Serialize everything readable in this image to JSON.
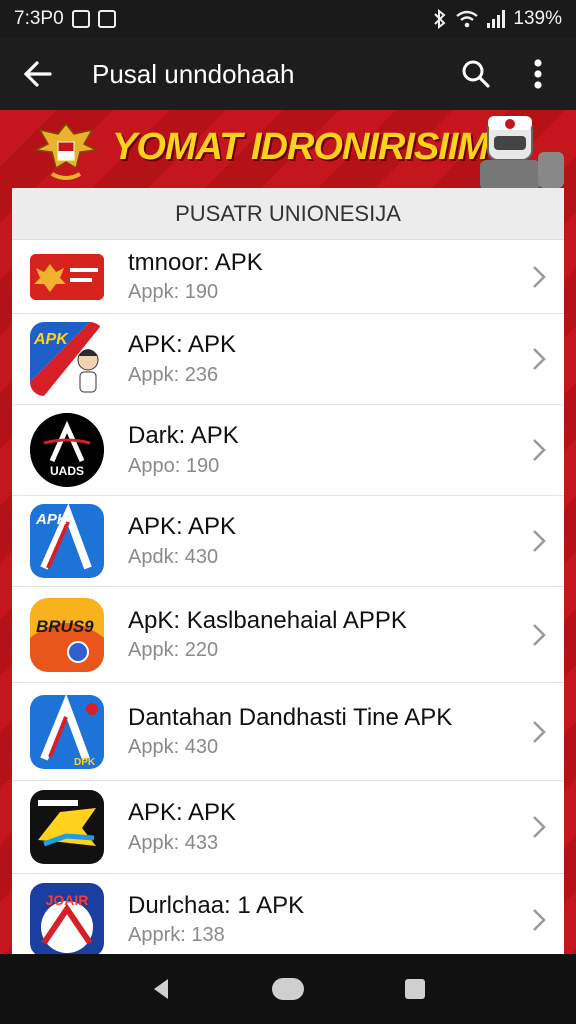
{
  "status_bar": {
    "time": "7:3P0",
    "battery": "139%",
    "icons": [
      "notification-icon",
      "notification-icon",
      "bluetooth-icon",
      "wifi-icon",
      "signal-icon"
    ]
  },
  "app_bar": {
    "title": "Pusal unndohaah",
    "back_icon": "arrow-left-icon",
    "search_icon": "search-icon",
    "menu_icon": "more-vertical-icon"
  },
  "banner": {
    "text": "YOMAT IDRONIRISIIM"
  },
  "panel": {
    "header": "PUSATR UNIONESIJA"
  },
  "apps": [
    {
      "name": "tmnoor: APK",
      "meta": "Appk: 190"
    },
    {
      "name": "APK:  APK",
      "meta": "Appk: 236"
    },
    {
      "name": "Dark:  APK",
      "meta": "Appo: 190"
    },
    {
      "name": "APK:  APK",
      "meta": "Apdk: 430"
    },
    {
      "name": "ApK: Kaslbanehaial APPK",
      "meta": "Appk: 220"
    },
    {
      "name": "Dantahan Dandhasti Tine APK",
      "meta": "Appk: 430"
    },
    {
      "name": "APK:  APK",
      "meta": "Appk: 433"
    },
    {
      "name": "Durlchaa: 1 APK",
      "meta": "Apprk: 138"
    }
  ],
  "icon_labels": {
    "apk_badge": "APK",
    "dark_badge": "UADS",
    "brush_badge": "BRUS9",
    "dpk_badge": "DPK",
    "last_badge": "JOAIR"
  },
  "nav_bar": {
    "icons": [
      "nav-back-icon",
      "nav-home-icon",
      "nav-recents-icon"
    ]
  },
  "colors": {
    "accent_red": "#c4161c",
    "banner_yellow": "#ffd21e"
  }
}
